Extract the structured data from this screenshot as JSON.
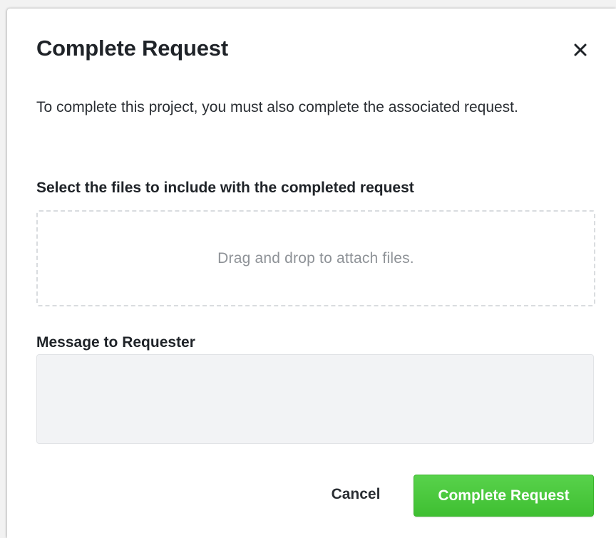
{
  "modal": {
    "title": "Complete Request",
    "close_icon": "close-icon",
    "description": "To complete this project, you must also complete the associated request.",
    "files_label": "Select the files to include with the completed request",
    "dropzone_text": "Drag and drop to attach files.",
    "message_label": "Message to Requester",
    "message_value": "",
    "cancel_label": "Cancel",
    "submit_label": "Complete Request"
  },
  "colors": {
    "accent_green": "#47c83a",
    "text_dark": "#1f2328",
    "muted_text": "#8e9297",
    "input_background": "#f2f3f5"
  }
}
